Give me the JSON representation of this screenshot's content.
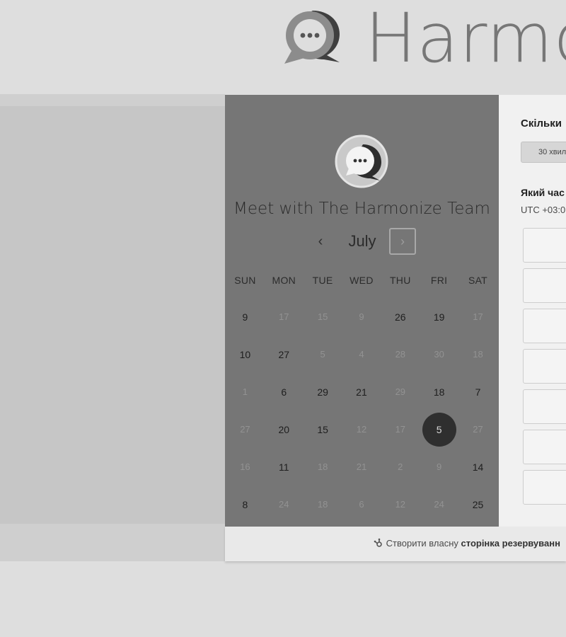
{
  "brand": {
    "name": "Harmo"
  },
  "calendar": {
    "title": "Meet with The Harmonize Team",
    "month": "July",
    "prev_icon": "‹",
    "next_icon": "›",
    "weekdays": [
      "SUN",
      "MON",
      "TUE",
      "WED",
      "THU",
      "FRI",
      "SAT"
    ],
    "weeks": [
      [
        "9",
        "17",
        "15",
        "9",
        "26",
        "19",
        "17"
      ],
      [
        "10",
        "27",
        "5",
        "4",
        "28",
        "30",
        "18"
      ],
      [
        "1",
        "6",
        "29",
        "21",
        "29",
        "18",
        "7"
      ],
      [
        "27",
        "20",
        "15",
        "12",
        "17",
        "5",
        "27"
      ],
      [
        "16",
        "11",
        "18",
        "21",
        "2",
        "9",
        "14"
      ],
      [
        "8",
        "24",
        "18",
        "6",
        "12",
        "24",
        "25"
      ]
    ],
    "selected_day": "5"
  },
  "booking": {
    "duration_label": "Скільки",
    "duration_option": "30 хвил",
    "time_label": "Який час",
    "timezone": "UTC +03:0"
  },
  "footer": {
    "prefix": "Створити власну",
    "strong": "сторінка резервуванн"
  },
  "colors": {
    "page_bg": "#dedede",
    "calendar_bg": "#767676",
    "selected_day_bg": "#2f2f2f",
    "right_panel_bg": "#f1f1f1"
  }
}
